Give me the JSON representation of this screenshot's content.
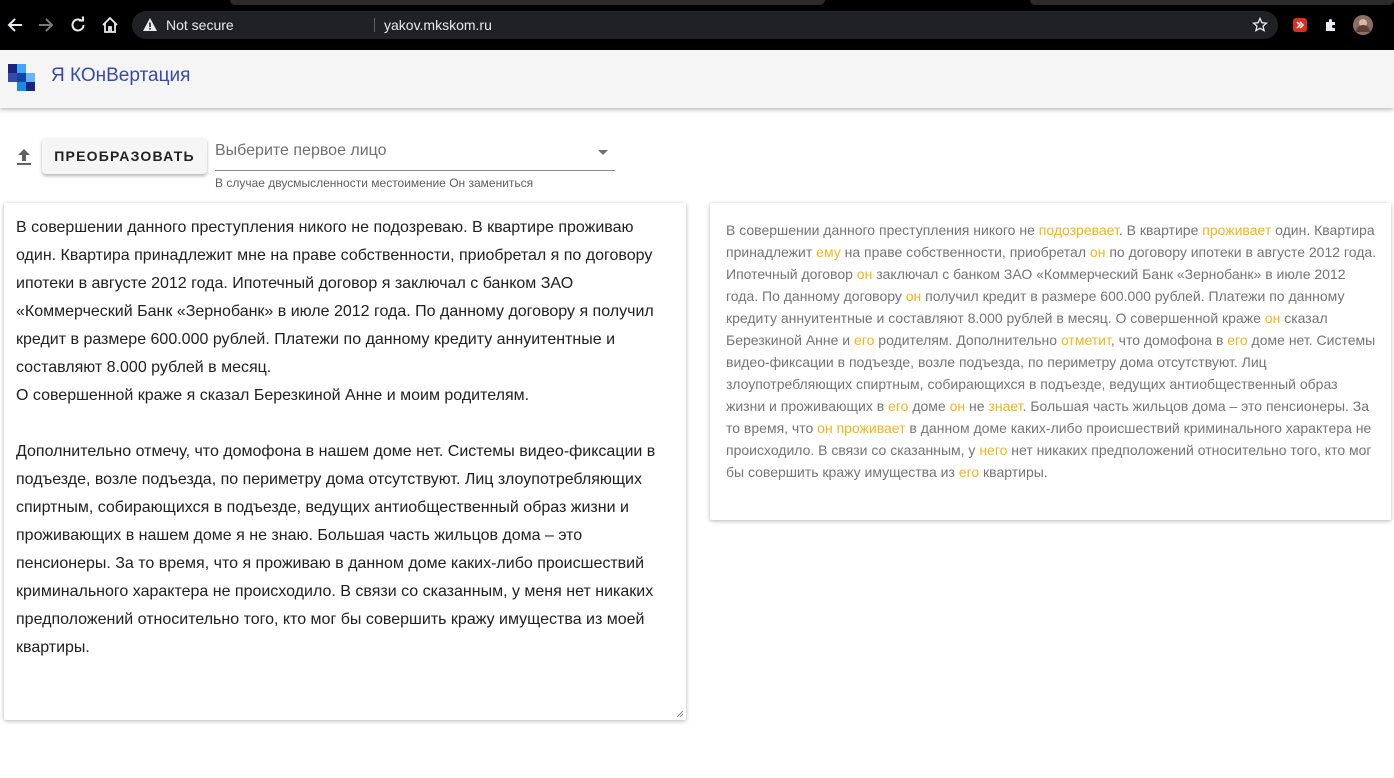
{
  "browser": {
    "security_label": "Not secure",
    "url": "yakov.mkskom.ru"
  },
  "app": {
    "title": "Я КОнВертация"
  },
  "toolbar": {
    "convert_label": "ПРЕОБРАЗОВАТЬ",
    "select_placeholder": "Выберите первое лицо",
    "select_hint": "В случае двусмысленности местоимение Он замениться"
  },
  "input": {
    "text": "В совершении данного преступления никого не подозреваю. В квартире проживаю один. Квартира принадлежит мне на праве собственности, приобретал я по договору ипотеки в августе 2012 года. Ипотечный договор я заключал с банком ЗАО «Коммерческий Банк «Зернобанк» в июле 2012 года. По данному договору я получил кредит в размере 600.000 рублей. Платежи по данному кредиту аннуитентные и составляют 8.000 рублей в месяц.\nО совершенной краже я сказал Березкиной Анне и моим родителям.\n\nДополнительно отмечу, что домофона в нашем доме нет. Системы видео-фиксации в подъезде, возле подъезда, по периметру дома отсутствуют. Лиц злоупотребляющих спиртным, собирающихся в подъезде, ведущих антиобщественный образ жизни и проживающих в нашем доме я не знаю. Большая часть жильцов дома – это пенсионеры. За то время, что я проживаю в данном доме каких-либо происшествий криминального характера не происходило. В связи со сказанным, у меня нет никаких предположений относительно того, кто мог бы совершить кражу имущества из моей квартиры."
  },
  "output": {
    "segments": [
      {
        "text": "В совершении данного преступления никого не ",
        "hl": false
      },
      {
        "text": "подозревает",
        "hl": true
      },
      {
        "text": ". В квартире ",
        "hl": false
      },
      {
        "text": "проживает",
        "hl": true
      },
      {
        "text": " один. Квартира принадлежит ",
        "hl": false
      },
      {
        "text": "ему",
        "hl": true
      },
      {
        "text": " на праве собственности, приобретал ",
        "hl": false
      },
      {
        "text": "он",
        "hl": true
      },
      {
        "text": " по договору ипотеки в августе 2012 года. Ипотечный договор ",
        "hl": false
      },
      {
        "text": "он",
        "hl": true
      },
      {
        "text": " заключал с банком ЗАО «Коммерческий Банк «Зернобанк» в июле 2012 года. По данному договору ",
        "hl": false
      },
      {
        "text": "он",
        "hl": true
      },
      {
        "text": " получил кредит в размере 600.000 рублей. Платежи по данному кредиту аннуитентные и составляют 8.000 рублей в месяц. О совершенной краже ",
        "hl": false
      },
      {
        "text": "он",
        "hl": true
      },
      {
        "text": " сказал Березкиной Анне и ",
        "hl": false
      },
      {
        "text": "его",
        "hl": true
      },
      {
        "text": " родителям. Дополнительно ",
        "hl": false
      },
      {
        "text": "отметит",
        "hl": true
      },
      {
        "text": ", что домофона в ",
        "hl": false
      },
      {
        "text": "его",
        "hl": true
      },
      {
        "text": " доме нет. Системы видео-фиксации в подъезде, возле подъезда, по периметру дома отсутствуют. Лиц злоупотребляющих спиртным, собирающихся в подъезде, ведущих антиобщественный образ жизни и проживающих в ",
        "hl": false
      },
      {
        "text": "его",
        "hl": true
      },
      {
        "text": " доме ",
        "hl": false
      },
      {
        "text": "он",
        "hl": true
      },
      {
        "text": " не ",
        "hl": false
      },
      {
        "text": "знает",
        "hl": true
      },
      {
        "text": ". Большая часть жильцов дома – это пенсионеры. За то время, что ",
        "hl": false
      },
      {
        "text": "он проживает",
        "hl": true
      },
      {
        "text": " в данном доме каких-либо происшествий криминального характера не происходило. В связи со сказанным, у ",
        "hl": false
      },
      {
        "text": "него",
        "hl": true
      },
      {
        "text": " нет никаких предположений относительно того, кто мог бы совершить кражу имущества из ",
        "hl": false
      },
      {
        "text": "его",
        "hl": true
      },
      {
        "text": " квартиры.",
        "hl": false
      }
    ]
  },
  "colors": {
    "title": "#3949ab",
    "highlight": "#f0b323",
    "output_text": "#757575"
  }
}
